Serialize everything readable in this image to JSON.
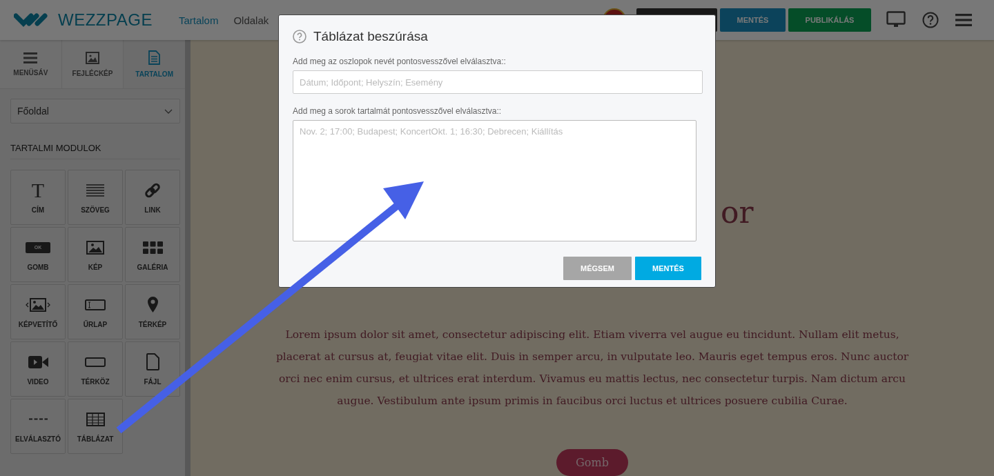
{
  "header": {
    "logo": "WEZZPAGE",
    "nav": [
      {
        "label": "Tartalom",
        "selected": true
      },
      {
        "label": "Oldalak",
        "selected": false
      }
    ],
    "buttons": [
      {
        "kind": "dark"
      },
      {
        "kind": "save",
        "label": "MENTÉS"
      },
      {
        "kind": "publish",
        "label": "PUBLIKÁLÁS"
      }
    ]
  },
  "sidebar": {
    "tabs": [
      {
        "kind": "menu",
        "label": "MENÜSÁV",
        "selected": false
      },
      {
        "kind": "image",
        "label": "FEJLÉCKÉP",
        "selected": false
      },
      {
        "kind": "document",
        "label": "TARTALOM",
        "selected": true
      }
    ],
    "page_select": {
      "value": "Főoldal"
    },
    "section_title": "TARTALMI MODULOK",
    "modules": [
      {
        "kind": "title",
        "label": "CÍM",
        "icon_text": "T"
      },
      {
        "kind": "text",
        "label": "SZÖVEG"
      },
      {
        "kind": "link",
        "label": "LINK"
      },
      {
        "kind": "button",
        "label": "GOMB",
        "icon_text": "OK"
      },
      {
        "kind": "image",
        "label": "KÉP"
      },
      {
        "kind": "gallery",
        "label": "GALÉRIA"
      },
      {
        "kind": "slider",
        "label": "KÉPVETÍTŐ"
      },
      {
        "kind": "form",
        "label": "ŰRLAP"
      },
      {
        "kind": "map",
        "label": "TÉRKÉP"
      },
      {
        "kind": "video",
        "label": "VIDEO"
      },
      {
        "kind": "spacer",
        "label": "TÉRKÖZ"
      },
      {
        "kind": "file",
        "label": "FÁJL"
      },
      {
        "kind": "divider",
        "label": "ELVÁLASZTÓ"
      },
      {
        "kind": "table",
        "label": "TÁBLÁZAT"
      }
    ]
  },
  "content": {
    "heading": "or",
    "paragraph": "Lorem ipsum dolor sit amet, consectetur adipiscing elit. Etiam viverra vel augue eu tincidunt. Nullam elit metus, placerat at cursus at, feugiat vitae elit. Duis in semper arcu, in vulputate leo. Mauris eget tempus eros. Nunc auctor orci nec enim cursus, et ultrices erat interdum. Vivamus eu mattis lectus, nec consectetur turpis. Nam dictum arcu augue. Vestibulum ante ipsum primis in faucibus orci luctus et ultrices posuere cubilia Curae.",
    "button": "Gomb"
  },
  "dialog": {
    "title": "Táblázat beszúrása",
    "fields": [
      {
        "kind": "input",
        "label": "Add meg az oszlopok nevét pontosvesszővel elválasztva::",
        "placeholder": "Dátum; Időpont; Helyszín; Esemény"
      },
      {
        "kind": "textarea",
        "label": "Add meg a sorok tartalmát pontosvesszővel elválasztva::",
        "placeholder": "Nov. 2; 17:00; Budapest; KoncertOkt. 1; 16:30; Debrecen; Kiállítás"
      }
    ],
    "buttons": [
      {
        "kind": "cancel",
        "label": "MÉGSEM"
      },
      {
        "kind": "primary",
        "label": "MENTÉS"
      }
    ]
  }
}
